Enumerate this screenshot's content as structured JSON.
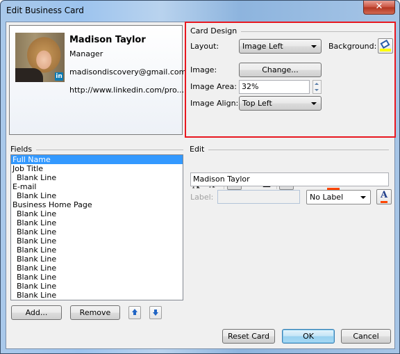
{
  "window": {
    "title": "Edit Business Card",
    "close_glyph": "✕"
  },
  "preview": {
    "name": "Madison Taylor",
    "job_title": "Manager",
    "email": "madisondiscovery@gmail.com",
    "web": "http://www.linkedin.com/pro...",
    "badge": "in"
  },
  "card_design": {
    "group_label": "Card Design",
    "layout_label": "Layout:",
    "layout_value": "Image Left",
    "background_label": "Background:",
    "background_color": "#ffff00",
    "image_label": "Image:",
    "change_button": "Change...",
    "image_area_label": "Image Area:",
    "image_area_value": "32%",
    "image_align_label": "Image Align:",
    "image_align_value": "Top Left"
  },
  "fields": {
    "group_label": "Fields",
    "items": [
      {
        "label": "Full Name",
        "indent": false,
        "selected": true
      },
      {
        "label": "Job Title",
        "indent": false
      },
      {
        "label": "Blank Line",
        "indent": true
      },
      {
        "label": "E-mail",
        "indent": false
      },
      {
        "label": "Blank Line",
        "indent": true
      },
      {
        "label": "Business Home Page",
        "indent": false
      },
      {
        "label": "Blank Line",
        "indent": true
      },
      {
        "label": "Blank Line",
        "indent": true
      },
      {
        "label": "Blank Line",
        "indent": true
      },
      {
        "label": "Blank Line",
        "indent": true
      },
      {
        "label": "Blank Line",
        "indent": true
      },
      {
        "label": "Blank Line",
        "indent": true
      },
      {
        "label": "Blank Line",
        "indent": true
      },
      {
        "label": "Blank Line",
        "indent": true
      },
      {
        "label": "Blank Line",
        "indent": true
      },
      {
        "label": "Blank Line",
        "indent": true
      }
    ],
    "add_button": "Add...",
    "remove_button": "Remove"
  },
  "edit": {
    "group_label": "Edit",
    "toolbar": {
      "grow_font": "A",
      "shrink_font": "A",
      "bold": "B",
      "italic": "I",
      "underline": "U",
      "font_color": "A",
      "font_color_value": "#ff4500"
    },
    "text_value": "Madison Taylor",
    "label_label": "Label:",
    "label_value": "",
    "label_position": "No Label",
    "label_color_glyph": "A"
  },
  "footer": {
    "reset_button": "Reset Card",
    "ok_button": "OK",
    "cancel_button": "Cancel"
  }
}
